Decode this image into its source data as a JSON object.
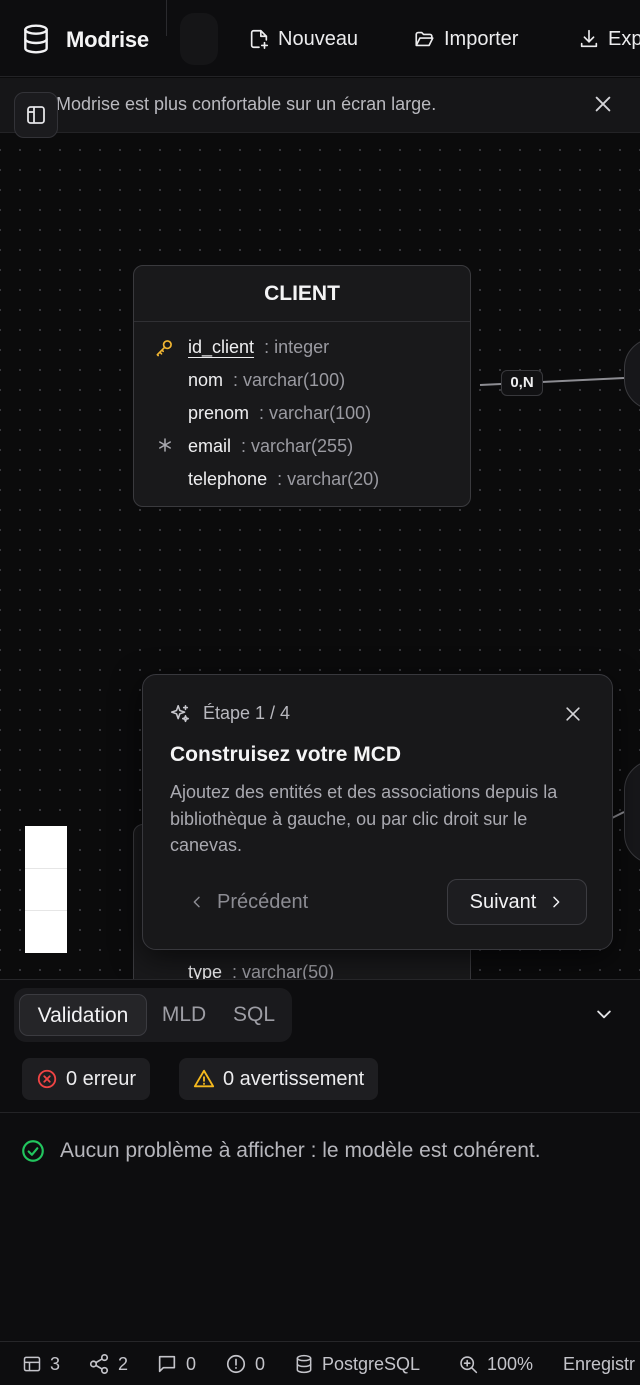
{
  "header": {
    "brand": "Modrise",
    "actions": [
      {
        "label": "Nouveau",
        "icon": "file-plus-icon"
      },
      {
        "label": "Importer",
        "icon": "folder-open-icon"
      },
      {
        "label": "Exp",
        "icon": "download-icon"
      }
    ]
  },
  "banner": {
    "text": "Modrise est plus confortable sur un écran large.",
    "icon": "info-icon"
  },
  "canvas": {
    "entity_client": {
      "title": "CLIENT",
      "attributes": [
        {
          "name": "id_client",
          "type": ": integer",
          "flag": "primary-key"
        },
        {
          "name": "nom",
          "type": ": varchar(100)",
          "flag": ""
        },
        {
          "name": "prenom",
          "type": ": varchar(100)",
          "flag": ""
        },
        {
          "name": "email",
          "type": ": varchar(255)",
          "flag": "required"
        },
        {
          "name": "telephone",
          "type": ": varchar(20)",
          "flag": ""
        }
      ]
    },
    "cardinality": "0,N",
    "entity_partial": {
      "attributes": [
        {
          "name": "type",
          "type": ": varchar(50)"
        }
      ]
    }
  },
  "tour": {
    "step": "Étape 1 / 4",
    "title": "Construisez votre MCD",
    "body": "Ajoutez des entités et des associations depuis la bibliothèque à gauche, ou par clic droit sur le canevas.",
    "prev_label": "Précédent",
    "next_label": "Suivant"
  },
  "bottom_panel": {
    "tabs": [
      "Validation",
      "MLD",
      "SQL"
    ],
    "active_tab": "Validation",
    "errors": "0 erreur",
    "warnings": "0 avertissement",
    "message": "Aucun problème à afficher : le modèle est cohérent."
  },
  "status_bar": {
    "entities": "3",
    "associations": "2",
    "comments": "0",
    "issues": "0",
    "dialect": "PostgreSQL",
    "zoom": "100%",
    "save_state": "Enregistr"
  },
  "colors": {
    "background": "#0b0b0c",
    "accent_key": "#f2b632",
    "error": "#ef4444",
    "warning": "#f5b91e",
    "success": "#22c55e"
  }
}
